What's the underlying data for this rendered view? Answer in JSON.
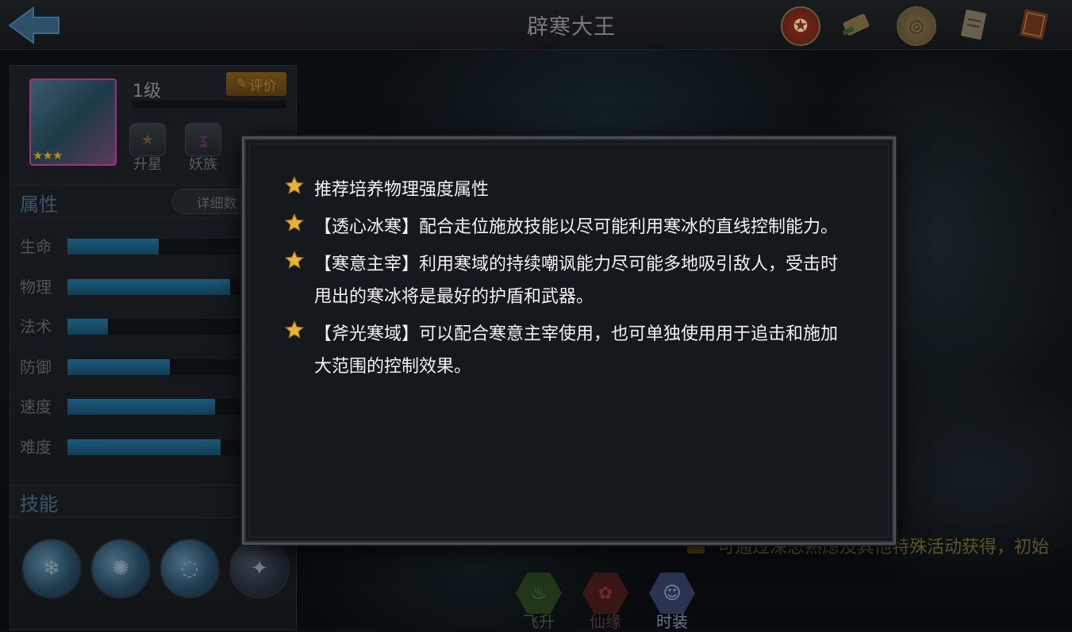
{
  "header": {
    "title": "辟寒大王",
    "back_icon": "back-arrow-icon",
    "right_icons": [
      "reward-badge-icon",
      "scroll-icon",
      "coin-medal-icon",
      "document-icon",
      "book-icon"
    ]
  },
  "hero": {
    "level": "1级",
    "stars": "★★★",
    "rate_button": "评价",
    "grade_buttons": [
      {
        "label": "升星",
        "icon": "star-upgrade-icon"
      },
      {
        "label": "妖族",
        "icon": "demon-clan-icon"
      }
    ]
  },
  "attributes": {
    "title": "属性",
    "detail_button": "详细数",
    "rows": [
      {
        "label": "生命",
        "fraction": 0.5
      },
      {
        "label": "物理",
        "fraction": 0.89
      },
      {
        "label": "法术",
        "fraction": 0.22
      },
      {
        "label": "防御",
        "fraction": 0.56
      },
      {
        "label": "速度",
        "fraction": 0.81
      },
      {
        "label": "难度",
        "fraction": 0.84
      }
    ]
  },
  "skills": {
    "title": "技能",
    "icons": [
      "ice-blade-skill-icon",
      "ice-beast-skill-icon",
      "ice-swirl-skill-icon",
      "ice-rune-skill-icon"
    ]
  },
  "hint": "可通过深思熟虑及其他特殊活动获得，初始",
  "bottom_buttons": [
    {
      "label": "飞升",
      "color": "#3a5a20"
    },
    {
      "label": "仙缘",
      "color": "#6a2020"
    },
    {
      "label": "时装",
      "color": "#3a4a7a"
    }
  ],
  "dialog": {
    "tips": [
      "推荐培养物理强度属性",
      "【透心冰寒】配合走位施放技能以尽可能利用寒冰的直线控制能力。",
      "【寒意主宰】利用寒域的持续嘲讽能力尽可能多地吸引敌人，受击时甩出的寒冰将是最好的护盾和武器。",
      "【斧光寒域】可以配合寒意主宰使用，也可单独使用用于追击和施加大范围的控制效果。"
    ]
  },
  "colors": {
    "accent_gold": "#e6b43a",
    "bar_blue": "#1c5a7c",
    "portrait_border": "#a0327a"
  }
}
